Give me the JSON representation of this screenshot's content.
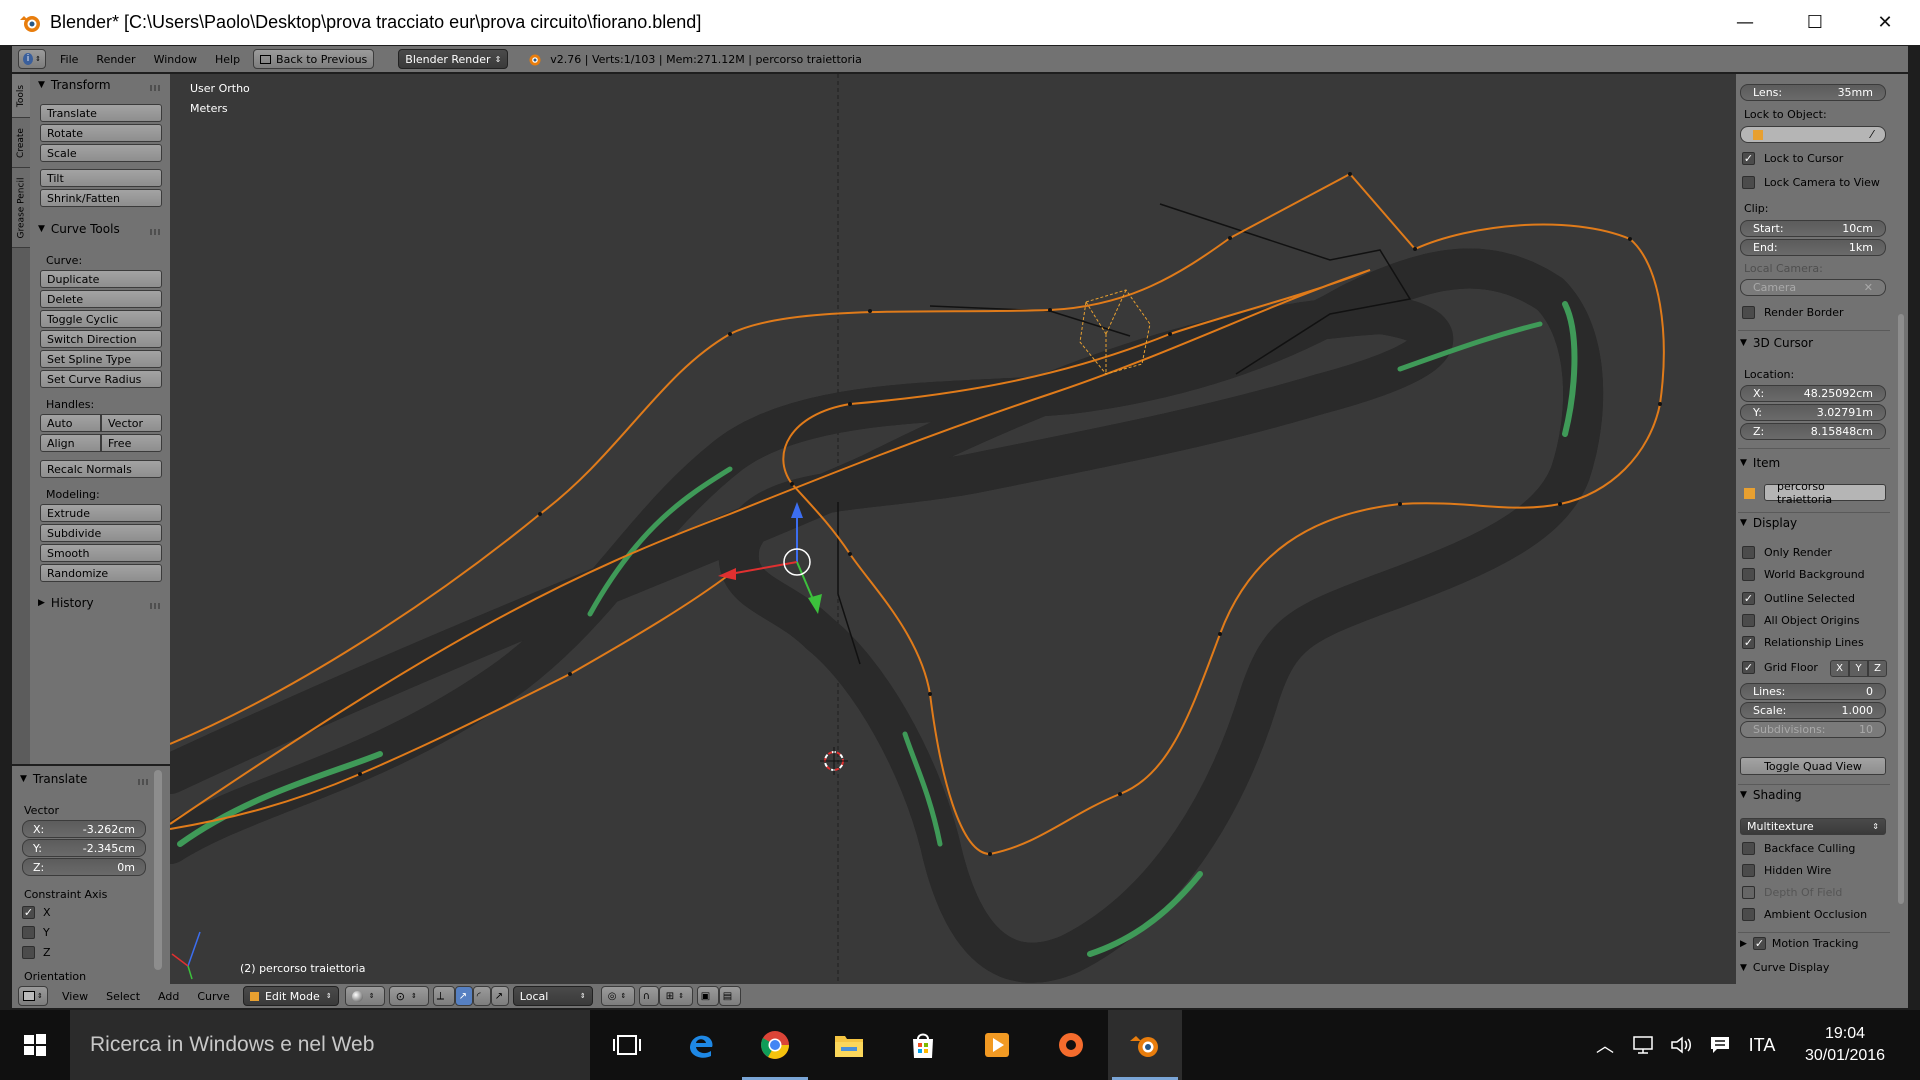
{
  "window": {
    "title": "Blender* [C:\\Users\\Paolo\\Desktop\\prova tracciato eur\\prova circuito\\fiorano.blend]",
    "minimize": "—",
    "maximize": "☐",
    "close": "✕"
  },
  "header": {
    "menus": [
      "File",
      "Render",
      "Window",
      "Help"
    ],
    "back_button": "Back to Previous",
    "render_engine": "Blender Render",
    "stats": "v2.76 | Verts:1/103 | Mem:271.12M | percorso traiettoria"
  },
  "tool_tabs": [
    "Tools",
    "Create",
    "Grease Pencil"
  ],
  "tools": {
    "transform": {
      "title": "Transform",
      "buttons": [
        "Translate",
        "Rotate",
        "Scale",
        "Tilt",
        "Shrink/Fatten"
      ]
    },
    "curve_tools": {
      "title": "Curve Tools",
      "curve_label": "Curve:",
      "curve_buttons": [
        "Duplicate",
        "Delete",
        "Toggle Cyclic",
        "Switch Direction",
        "Set Spline Type",
        "Set Curve Radius"
      ],
      "handles_label": "Handles:",
      "handle_buttons": [
        "Auto",
        "Vector",
        "Align",
        "Free"
      ],
      "recalc": "Recalc Normals",
      "modeling_label": "Modeling:",
      "modeling_buttons": [
        "Extrude",
        "Subdivide",
        "Smooth",
        "Randomize"
      ]
    },
    "history": {
      "title": "History"
    }
  },
  "redo_panel": {
    "title": "Translate",
    "vector_label": "Vector",
    "x": {
      "label": "X:",
      "value": "-3.262cm"
    },
    "y": {
      "label": "Y:",
      "value": "-2.345cm"
    },
    "z": {
      "label": "Z:",
      "value": "0m"
    },
    "constraint_label": "Constraint Axis",
    "constraints": [
      {
        "label": "X",
        "checked": true
      },
      {
        "label": "Y",
        "checked": false
      },
      {
        "label": "Z",
        "checked": false
      }
    ],
    "orientation_label": "Orientation"
  },
  "viewport": {
    "view_name": "User Ortho",
    "units": "Meters",
    "object_label": "(2) percorso traiettoria",
    "colors": {
      "background": "#393939",
      "spline": "#e07b1a",
      "road": "#8c8c8c",
      "grass": "#3f9a58"
    }
  },
  "properties": {
    "lens": {
      "label": "Lens:",
      "value": "35mm"
    },
    "lock_to_object": "Lock to Object:",
    "lock_to_cursor": {
      "label": "Lock to Cursor",
      "checked": true
    },
    "lock_camera_to_view": {
      "label": "Lock Camera to View",
      "checked": false
    },
    "clip_label": "Clip:",
    "clip_start": {
      "label": "Start:",
      "value": "10cm"
    },
    "clip_end": {
      "label": "End:",
      "value": "1km"
    },
    "local_camera_label": "Local Camera:",
    "local_camera_value": "Camera",
    "render_border": {
      "label": "Render Border",
      "checked": false
    },
    "cursor_section": "3D Cursor",
    "location_label": "Location:",
    "cursor_x": {
      "label": "X:",
      "value": "48.25092cm"
    },
    "cursor_y": {
      "label": "Y:",
      "value": "3.02791m"
    },
    "cursor_z": {
      "label": "Z:",
      "value": "8.15848cm"
    },
    "item_section": "Item",
    "item_name": "percorso traiettoria",
    "display_section": "Display",
    "display_checks": [
      {
        "label": "Only Render",
        "checked": false
      },
      {
        "label": "World Background",
        "checked": false
      },
      {
        "label": "Outline Selected",
        "checked": true
      },
      {
        "label": "All Object Origins",
        "checked": false
      },
      {
        "label": "Relationship Lines",
        "checked": true
      }
    ],
    "grid_floor": {
      "label": "Grid Floor",
      "checked": true,
      "axes": [
        "X",
        "Y",
        "Z"
      ]
    },
    "lines": {
      "label": "Lines:",
      "value": "0"
    },
    "scale": {
      "label": "Scale:",
      "value": "1.000"
    },
    "subdivisions": {
      "label": "Subdivisions:",
      "value": "10"
    },
    "toggle_quad": "Toggle Quad View",
    "shading_section": "Shading",
    "shading_mode": "Multitexture",
    "shading_checks": [
      {
        "label": "Backface Culling",
        "checked": false,
        "dim": false
      },
      {
        "label": "Hidden Wire",
        "checked": false,
        "dim": false
      },
      {
        "label": "Depth Of Field",
        "checked": false,
        "dim": true
      },
      {
        "label": "Ambient Occlusion",
        "checked": false,
        "dim": false
      }
    ],
    "motion_tracking": {
      "label": "Motion Tracking",
      "checked": true
    },
    "curve_display": "Curve Display"
  },
  "footer": {
    "menus": [
      "View",
      "Select",
      "Add",
      "Curve"
    ],
    "mode": "Edit Mode",
    "orientation": "Local"
  },
  "taskbar": {
    "search_placeholder": "Ricerca in Windows e nel Web",
    "language": "ITA",
    "time": "19:04",
    "date": "30/01/2016"
  }
}
